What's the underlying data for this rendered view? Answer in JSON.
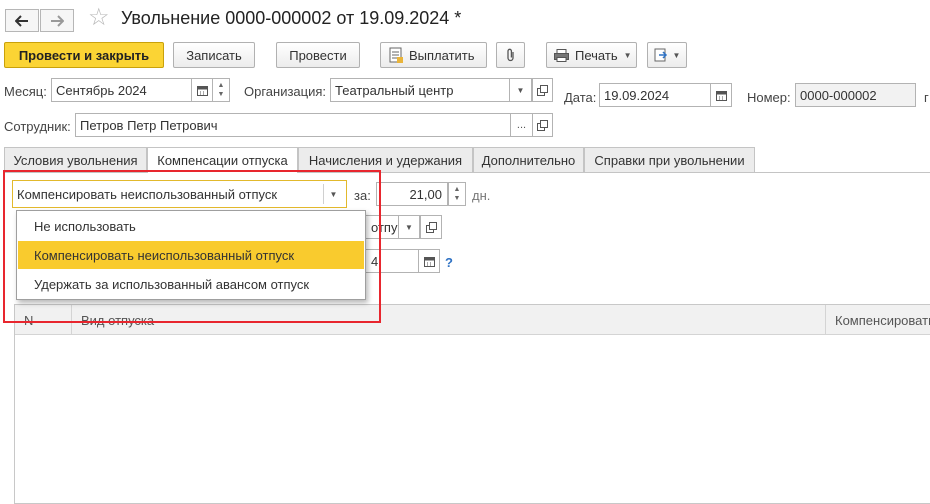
{
  "window": {
    "title": "Увольнение 0000-000002 от 19.09.2024 *"
  },
  "toolbar": {
    "post_close": "Провести и закрыть",
    "save": "Записать",
    "post": "Провести",
    "pay": "Выплатить",
    "print": "Печать"
  },
  "form": {
    "month_label": "Месяц:",
    "month_value": "Сентябрь 2024",
    "org_label": "Организация:",
    "org_value": "Театральный центр",
    "date_label": "Дата:",
    "date_value": "19.09.2024",
    "number_label": "Номер:",
    "number_value": "0000-000002",
    "number_suffix": "г",
    "employee_label": "Сотрудник:",
    "employee_value": "Петров Петр Петрович"
  },
  "tabs": [
    {
      "label": "Условия увольнения"
    },
    {
      "label": "Компенсации отпуска"
    },
    {
      "label": "Начисления и удержания"
    },
    {
      "label": "Дополнительно"
    },
    {
      "label": "Справки при увольнении"
    }
  ],
  "compensation": {
    "select_value": "Компенсировать неиспользованный отпуск",
    "for_label": "за:",
    "days_value": "21,00",
    "days_unit": "дн.",
    "hidden_select_partial": "отпу",
    "hidden_date_partial": "4",
    "help_icon": "?"
  },
  "dropdown": {
    "options": [
      "Не использовать",
      "Компенсировать неиспользованный отпуск",
      "Удержать за использованный авансом отпуск"
    ],
    "selected_index": 1
  },
  "table": {
    "columns": [
      "N",
      "Вид отпуска",
      "Компенсировать"
    ]
  },
  "colors": {
    "primary_button": "#fbd434",
    "selected_option": "#f9cb2e",
    "highlight_box": "#e8262e"
  }
}
